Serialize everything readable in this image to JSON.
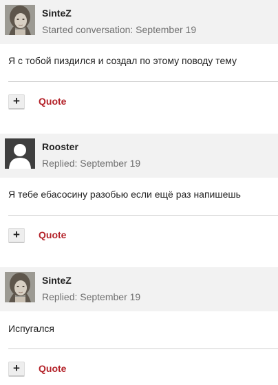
{
  "posts": [
    {
      "author": "SinteZ",
      "meta": "Started conversation: September 19",
      "avatar": "user-photo-avatar",
      "text": "Я с тобой пиздился и создал по этому поводу тему",
      "plus_label": "+",
      "quote_label": "Quote"
    },
    {
      "author": "Rooster",
      "meta": "Replied: September 19",
      "avatar": "default-user-avatar",
      "text": "Я тебе ебасосину разобью если ещё раз напишешь",
      "plus_label": "+",
      "quote_label": "Quote"
    },
    {
      "author": "SinteZ",
      "meta": "Replied: September 19",
      "avatar": "user-photo-avatar",
      "text": "Испугался",
      "plus_label": "+",
      "quote_label": "Quote"
    }
  ],
  "colors": {
    "header_bg": "#f2f2f2",
    "quote_link": "#b4232a",
    "meta_text": "#6f6f6f"
  }
}
